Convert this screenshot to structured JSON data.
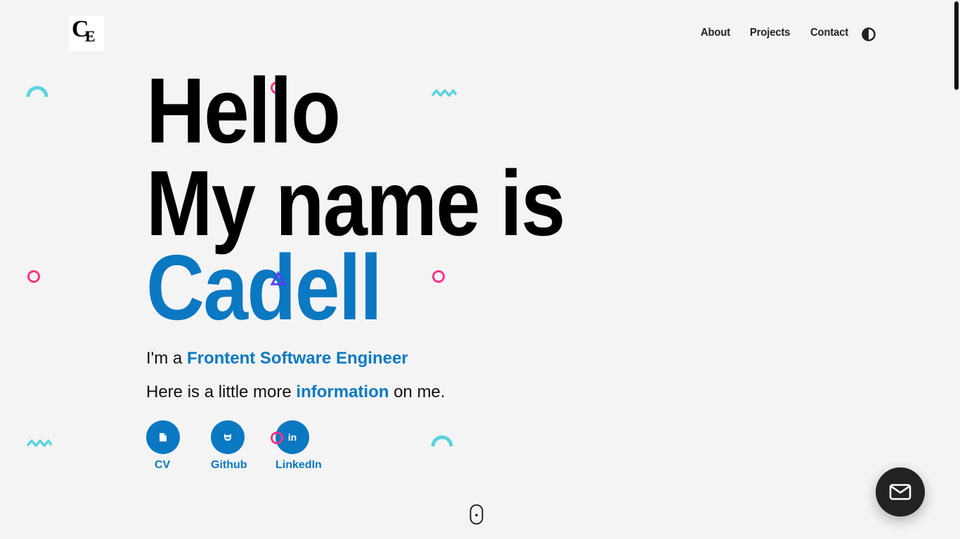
{
  "logo": {
    "letter1": "C",
    "letter2": "E"
  },
  "nav": {
    "items": [
      {
        "label": "About"
      },
      {
        "label": "Projects"
      },
      {
        "label": "Contact"
      }
    ],
    "theme_toggle_icon": "contrast-half-circle-icon"
  },
  "hero": {
    "line1": "Hello",
    "line2": "My name is",
    "name": "Cadell"
  },
  "intro": {
    "prefix": "I'm a ",
    "role": "Frontent Software Engineer",
    "info_prefix": "Here is a little more ",
    "info_link": "information",
    "info_suffix": " on me."
  },
  "social": [
    {
      "label": "CV",
      "icon": "file-icon"
    },
    {
      "label": "Github",
      "icon": "github-icon"
    },
    {
      "label": "LinkedIn",
      "icon": "linkedin-icon",
      "glyph": "in"
    }
  ],
  "scroll_indicator": "mouse-scroll-icon",
  "contact_fab": {
    "icon": "mail-icon"
  },
  "colors": {
    "accent": "#0b78c2",
    "background": "#f4f4f4",
    "decor_cyan": "#5bd3e0",
    "decor_pink": "#f5348a",
    "decor_purple": "#5a3cf5",
    "fab": "#222222"
  }
}
